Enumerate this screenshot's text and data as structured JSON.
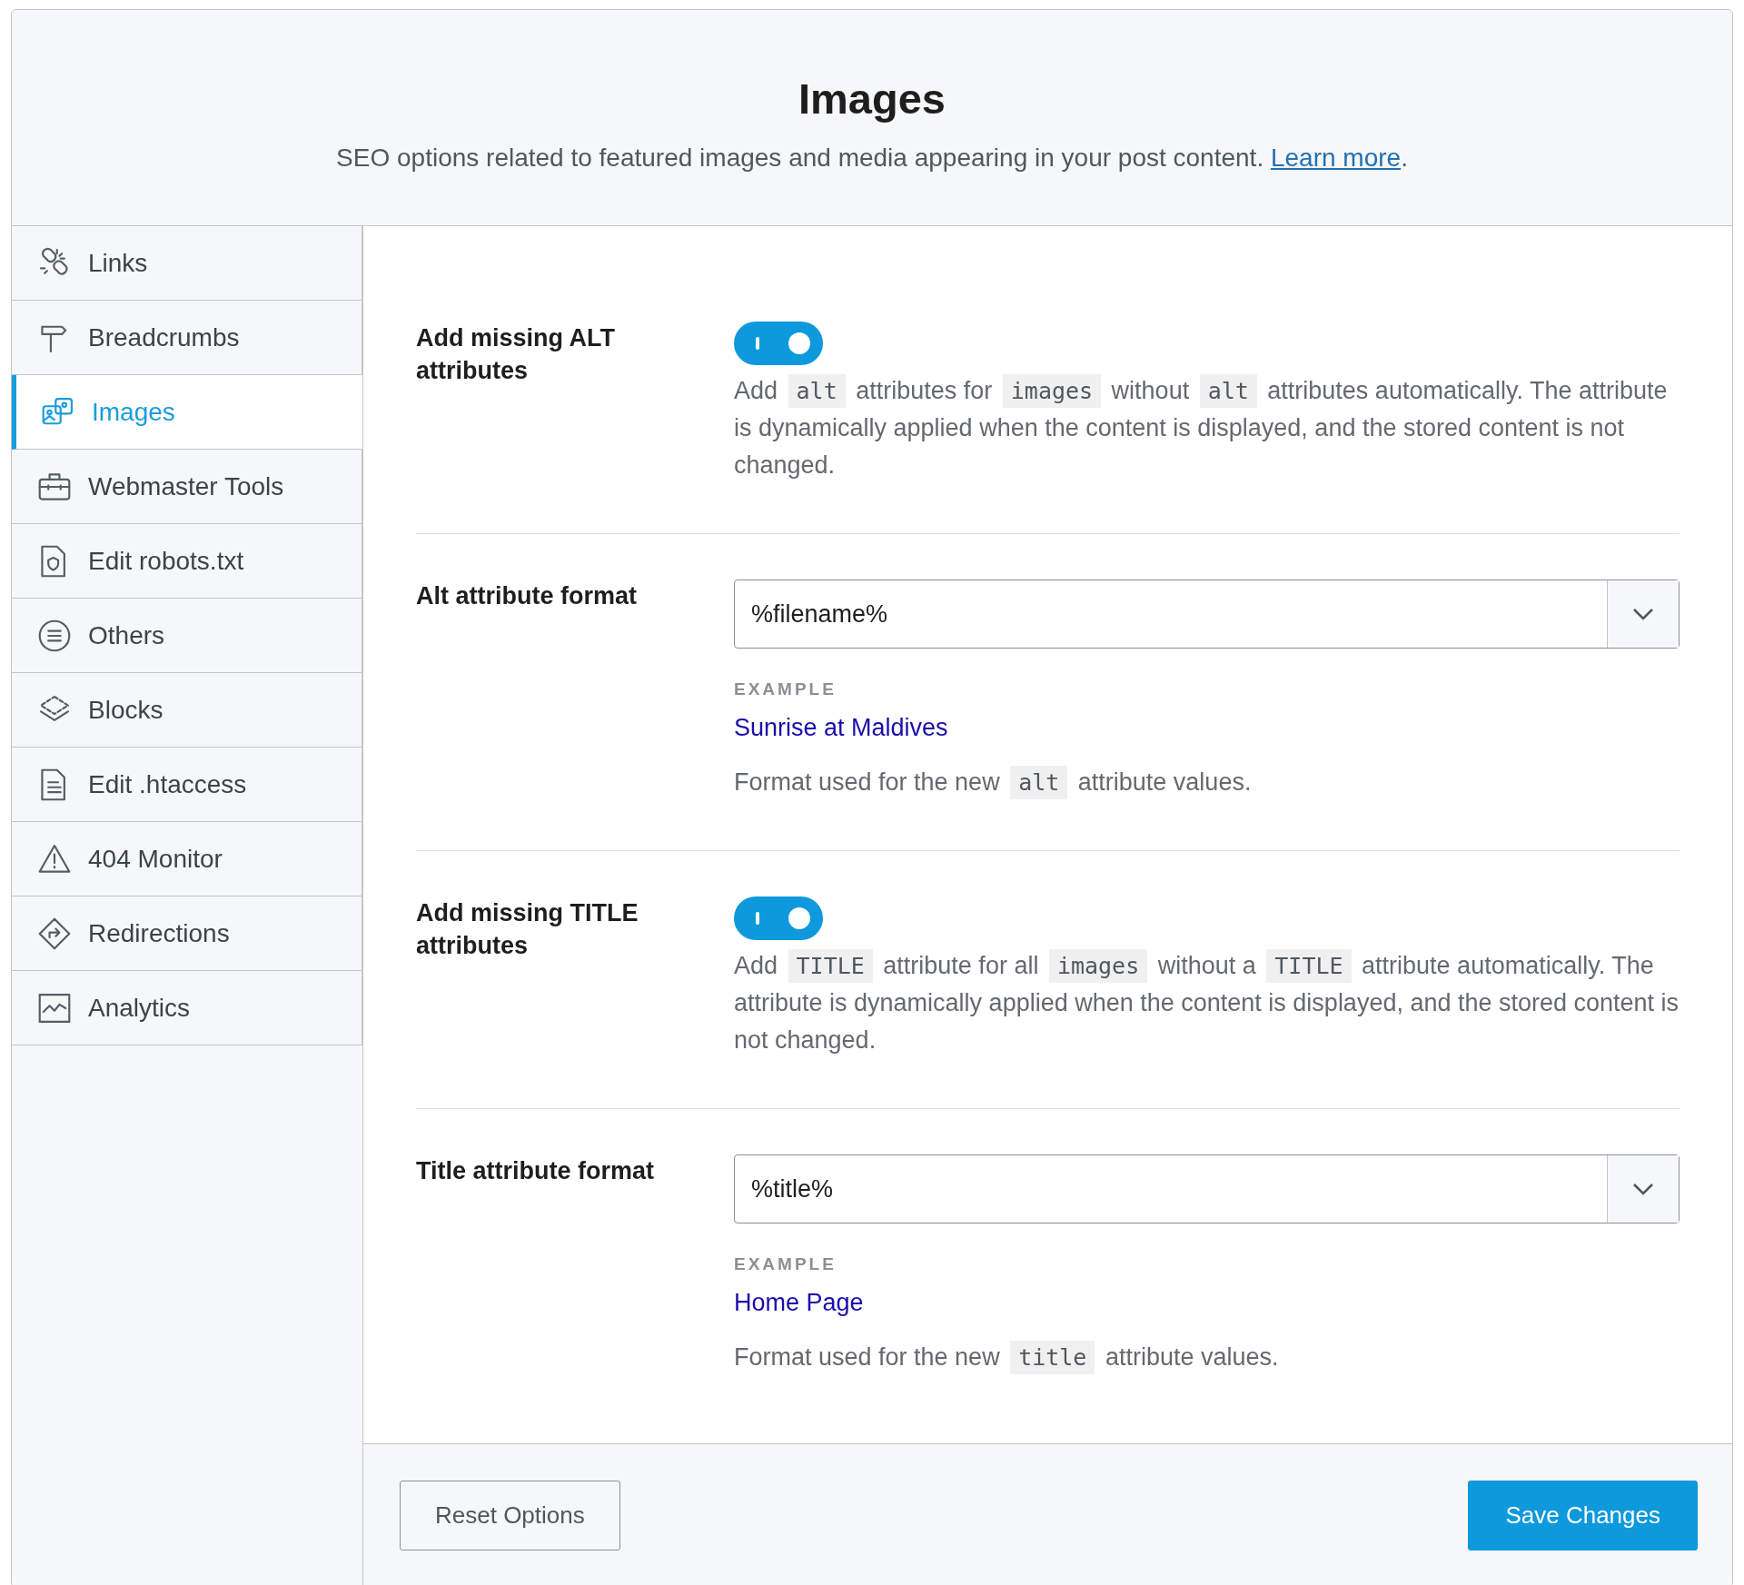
{
  "header": {
    "title": "Images",
    "description": "SEO options related to featured images and media appearing in your post content. ",
    "link": "Learn more",
    "link_suffix": "."
  },
  "sidebar": {
    "items": [
      {
        "label": "Links",
        "selected": false
      },
      {
        "label": "Breadcrumbs",
        "selected": false
      },
      {
        "label": "Images",
        "selected": true
      },
      {
        "label": "Webmaster Tools",
        "selected": false
      },
      {
        "label": "Edit robots.txt",
        "selected": false
      },
      {
        "label": "Others",
        "selected": false
      },
      {
        "label": "Blocks",
        "selected": false
      },
      {
        "label": "Edit .htaccess",
        "selected": false
      },
      {
        "label": "404 Monitor",
        "selected": false
      },
      {
        "label": "Redirections",
        "selected": false
      },
      {
        "label": "Analytics",
        "selected": false
      }
    ]
  },
  "settings": [
    {
      "kind": "toggle",
      "label": "Add missing ALT attributes",
      "on": true,
      "description": [
        {
          "text": "Add "
        },
        {
          "code": "alt"
        },
        {
          "text": " attributes for "
        },
        {
          "code": "images"
        },
        {
          "text": " without "
        },
        {
          "code": "alt"
        },
        {
          "text": " attributes automatically. The attribute is dynamically applied when the content is displayed, and the stored content is not changed."
        }
      ]
    },
    {
      "kind": "select",
      "label": "Alt attribute format",
      "value": "%filename%",
      "example_label": "EXAMPLE",
      "example": "Sunrise at Maldives",
      "description": [
        {
          "text": "Format used for the new "
        },
        {
          "code": "alt"
        },
        {
          "text": " attribute values."
        }
      ]
    },
    {
      "kind": "toggle",
      "label": "Add missing TITLE attributes",
      "on": true,
      "description": [
        {
          "text": "Add "
        },
        {
          "code": "TITLE"
        },
        {
          "text": " attribute for all "
        },
        {
          "code": "images"
        },
        {
          "text": " without a "
        },
        {
          "code": "TITLE"
        },
        {
          "text": " attribute automatically. The attribute is dynamically applied when the content is displayed, and the stored content is not changed."
        }
      ]
    },
    {
      "kind": "select",
      "label": "Title attribute format",
      "value": "%title%",
      "example_label": "EXAMPLE",
      "example": "Home Page",
      "description": [
        {
          "text": "Format used for the new "
        },
        {
          "code": "title"
        },
        {
          "text": " attribute values."
        }
      ]
    }
  ],
  "footer": {
    "reset_button": "Reset Options",
    "save_button": "Save Changes"
  }
}
